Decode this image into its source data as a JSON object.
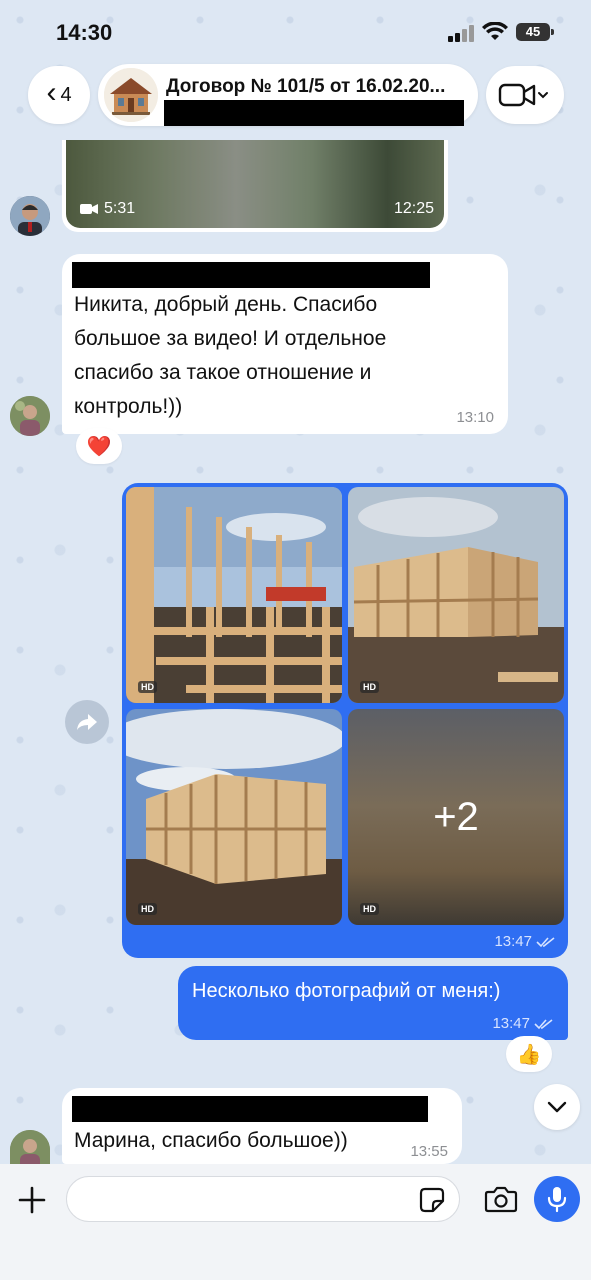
{
  "status_bar": {
    "time": "14:30",
    "battery": "45"
  },
  "header": {
    "back_count": "4",
    "title": "Договор № 101/5 от 16.02.20..."
  },
  "messages": {
    "video": {
      "duration": "5:31",
      "time": "12:25"
    },
    "incoming_1": {
      "text": "Никита, добрый день. Спасибо большое за видео! И отдельное спасибо за такое отношение и контроль!))",
      "lines": [
        "Никита, добрый день. Спасибо",
        "большое за видео! И отдельное",
        "спасибо за такое отношение и",
        "контроль!))"
      ],
      "time": "13:10",
      "reaction": "❤️"
    },
    "album": {
      "photos": [
        {
          "label": "HD",
          "icon": "photo-frame-interior"
        },
        {
          "label": "HD",
          "icon": "photo-frame-side"
        },
        {
          "label": "HD",
          "icon": "photo-frame-exterior"
        },
        {
          "label": "HD",
          "icon": "photo-blurred-more",
          "more": "+2"
        }
      ],
      "time": "13:47"
    },
    "outgoing_1": {
      "text": "Несколько фотографий от меня:)",
      "time": "13:47",
      "reaction": "👍"
    },
    "incoming_2": {
      "text": "Марина, спасибо большое))",
      "time": "13:55"
    }
  },
  "colors": {
    "accent": "#2f6ef2",
    "bubble_in": "#ffffff",
    "chat_background": "#dde7f3",
    "time_gray": "#8d8f93"
  }
}
